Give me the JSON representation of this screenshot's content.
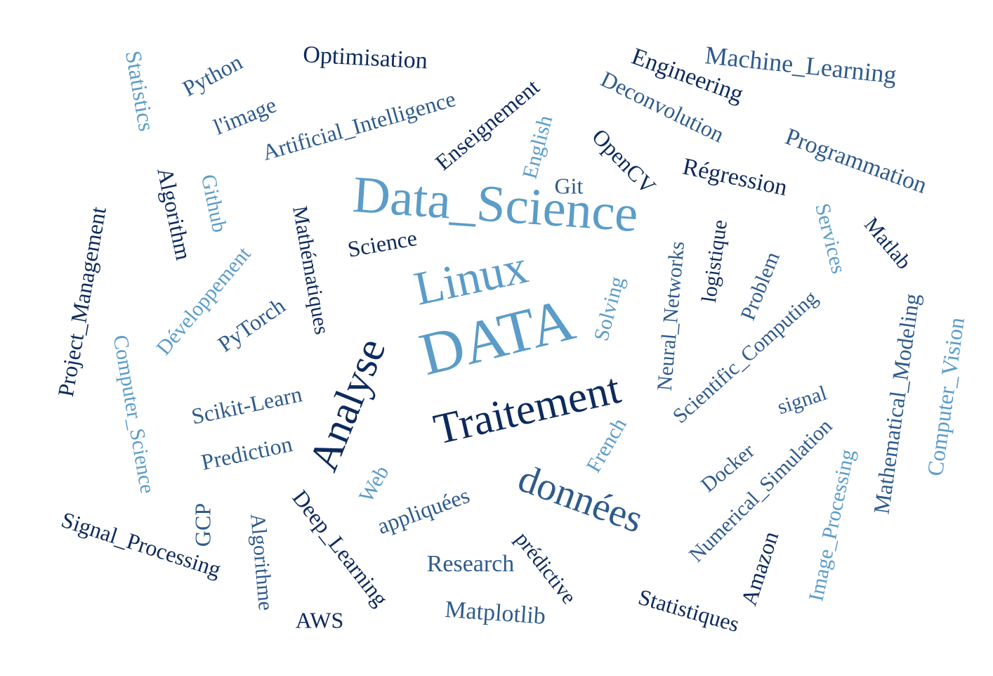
{
  "palette": {
    "dark": "#0d2a5c",
    "mid": "#2f5b8c",
    "light": "#5b9cc8"
  },
  "words": [
    {
      "text": "Data_Science",
      "color": "light",
      "weight": 10
    },
    {
      "text": "DATA",
      "color": "light",
      "weight": 10
    },
    {
      "text": "Linux",
      "color": "light",
      "weight": 9
    },
    {
      "text": "Traitement",
      "color": "dark",
      "weight": 9
    },
    {
      "text": "Analyse",
      "color": "dark",
      "weight": 9
    },
    {
      "text": "données",
      "color": "mid",
      "weight": 9
    },
    {
      "text": "Machine_Learning",
      "color": "mid",
      "weight": 5
    },
    {
      "text": "Engineering",
      "color": "dark",
      "weight": 5
    },
    {
      "text": "Deconvolution",
      "color": "mid",
      "weight": 5
    },
    {
      "text": "Programmation",
      "color": "mid",
      "weight": 5
    },
    {
      "text": "Régression",
      "color": "dark",
      "weight": 5
    },
    {
      "text": "OpenCV",
      "color": "dark",
      "weight": 5
    },
    {
      "text": "Optimisation",
      "color": "dark",
      "weight": 5
    },
    {
      "text": "Python",
      "color": "mid",
      "weight": 5
    },
    {
      "text": "Statistics",
      "color": "light",
      "weight": 5
    },
    {
      "text": "l'image",
      "color": "mid",
      "weight": 5
    },
    {
      "text": "Artificial_Intelligence",
      "color": "mid",
      "weight": 5
    },
    {
      "text": "Enseignement",
      "color": "dark",
      "weight": 5
    },
    {
      "text": "English",
      "color": "light",
      "weight": 5
    },
    {
      "text": "Git",
      "color": "mid",
      "weight": 5
    },
    {
      "text": "Algorithm",
      "color": "dark",
      "weight": 5
    },
    {
      "text": "Github",
      "color": "light",
      "weight": 5
    },
    {
      "text": "Mathématiques",
      "color": "dark",
      "weight": 5
    },
    {
      "text": "Science",
      "color": "dark",
      "weight": 5
    },
    {
      "text": "Project_Management",
      "color": "dark",
      "weight": 5
    },
    {
      "text": "Développement",
      "color": "light",
      "weight": 5
    },
    {
      "text": "Computer_Science",
      "color": "light",
      "weight": 5
    },
    {
      "text": "PyTorch",
      "color": "mid",
      "weight": 5
    },
    {
      "text": "Scikit-Learn",
      "color": "mid",
      "weight": 5
    },
    {
      "text": "Prediction",
      "color": "mid",
      "weight": 5
    },
    {
      "text": "Solving",
      "color": "light",
      "weight": 5
    },
    {
      "text": "Neural_Networks",
      "color": "mid",
      "weight": 5
    },
    {
      "text": "logistique",
      "color": "dark",
      "weight": 5
    },
    {
      "text": "Problem",
      "color": "mid",
      "weight": 5
    },
    {
      "text": "Services",
      "color": "light",
      "weight": 5
    },
    {
      "text": "Matlab",
      "color": "dark",
      "weight": 5
    },
    {
      "text": "Scientific_Computing",
      "color": "mid",
      "weight": 5
    },
    {
      "text": "signal",
      "color": "mid",
      "weight": 5
    },
    {
      "text": "Mathematical_Modeling",
      "color": "mid",
      "weight": 5
    },
    {
      "text": "Computer_Vision",
      "color": "light",
      "weight": 5
    },
    {
      "text": "French",
      "color": "light",
      "weight": 5
    },
    {
      "text": "Docker",
      "color": "mid",
      "weight": 5
    },
    {
      "text": "Numerical_Simulation",
      "color": "mid",
      "weight": 5
    },
    {
      "text": "Image_Processing",
      "color": "light",
      "weight": 5
    },
    {
      "text": "Web",
      "color": "light",
      "weight": 5
    },
    {
      "text": "appliquées",
      "color": "mid",
      "weight": 5
    },
    {
      "text": "Deep_Learning",
      "color": "dark",
      "weight": 5
    },
    {
      "text": "prédictive",
      "color": "dark",
      "weight": 5
    },
    {
      "text": "Research",
      "color": "mid",
      "weight": 5
    },
    {
      "text": "Matplotlib",
      "color": "mid",
      "weight": 5
    },
    {
      "text": "Signal_Processing",
      "color": "dark",
      "weight": 5
    },
    {
      "text": "GCP",
      "color": "mid",
      "weight": 5
    },
    {
      "text": "Algorithme",
      "color": "mid",
      "weight": 5
    },
    {
      "text": "AWS",
      "color": "dark",
      "weight": 5
    },
    {
      "text": "Statistiques",
      "color": "dark",
      "weight": 5
    },
    {
      "text": "Amazon",
      "color": "dark",
      "weight": 5
    }
  ]
}
